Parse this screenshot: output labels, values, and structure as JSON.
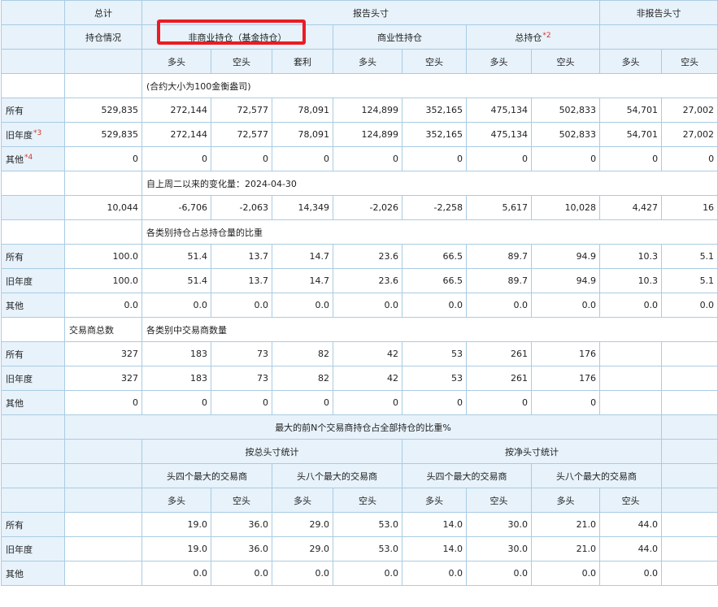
{
  "header": {
    "total": "总计",
    "reportable": "报告头寸",
    "nonreportable": "非报告头寸",
    "positions": "持仓情况",
    "noncommercial": "非商业持仓（基金持仓）",
    "commercial": "商业性持仓",
    "total_positions": "总持仓",
    "total_positions_note": "*2",
    "long": "多头",
    "short": "空头",
    "spreading": "套利"
  },
  "contract_unit": "(合约大小为100金衡盎司)",
  "rows": {
    "all": "所有",
    "old": "旧年度",
    "old_note": "*3",
    "other": "其他",
    "other_note": "*4"
  },
  "positions": {
    "all": [
      "529,835",
      "272,144",
      "72,577",
      "78,091",
      "124,899",
      "352,165",
      "475,134",
      "502,833",
      "54,701",
      "27,002"
    ],
    "old": [
      "529,835",
      "272,144",
      "72,577",
      "78,091",
      "124,899",
      "352,165",
      "475,134",
      "502,833",
      "54,701",
      "27,002"
    ],
    "other": [
      "0",
      "0",
      "0",
      "0",
      "0",
      "0",
      "0",
      "0",
      "0",
      "0"
    ]
  },
  "changes": {
    "label": "自上周二以来的变化量：2024-04-30",
    "values": [
      "10,044",
      "-6,706",
      "-2,063",
      "14,349",
      "-2,026",
      "-2,258",
      "5,617",
      "10,028",
      "4,427",
      "16"
    ]
  },
  "percent": {
    "label": "各类别持仓占总持仓量的比重",
    "all": [
      "100.0",
      "51.4",
      "13.7",
      "14.7",
      "23.6",
      "66.5",
      "89.7",
      "94.9",
      "10.3",
      "5.1"
    ],
    "old": [
      "100.0",
      "51.4",
      "13.7",
      "14.7",
      "23.6",
      "66.5",
      "89.7",
      "94.9",
      "10.3",
      "5.1"
    ],
    "other": [
      "0.0",
      "0.0",
      "0.0",
      "0.0",
      "0.0",
      "0.0",
      "0.0",
      "0.0",
      "0.0",
      "0.0"
    ]
  },
  "traders": {
    "total_label": "交易商总数",
    "label": "各类别中交易商数量",
    "all": [
      "327",
      "183",
      "73",
      "82",
      "42",
      "53",
      "261",
      "176"
    ],
    "old": [
      "327",
      "183",
      "73",
      "82",
      "42",
      "53",
      "261",
      "176"
    ],
    "other": [
      "0",
      "0",
      "0",
      "0",
      "0",
      "0",
      "0",
      "0"
    ]
  },
  "concentration": {
    "title": "最大的前N个交易商持仓占全部持仓的比重%",
    "by_gross": "按总头寸统计",
    "by_net": "按净头寸统计",
    "top4": "头四个最大的交易商",
    "top8": "头八个最大的交易商",
    "all": [
      "19.0",
      "36.0",
      "29.0",
      "53.0",
      "14.0",
      "30.0",
      "21.0",
      "44.0"
    ],
    "old": [
      "19.0",
      "36.0",
      "29.0",
      "53.0",
      "14.0",
      "30.0",
      "21.0",
      "44.0"
    ],
    "other": [
      "0.0",
      "0.0",
      "0.0",
      "0.0",
      "0.0",
      "0.0",
      "0.0",
      "0.0"
    ]
  },
  "highlight_color": "#ec1b24"
}
